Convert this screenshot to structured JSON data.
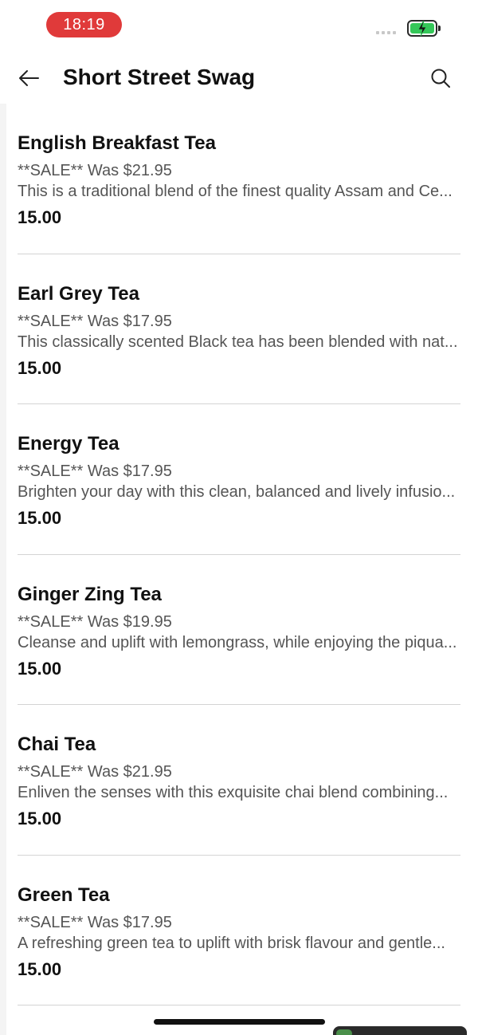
{
  "status_bar": {
    "time": "18:19"
  },
  "app_bar": {
    "title": "Short Street Swag",
    "back_icon": "arrow-left-icon",
    "search_icon": "search-icon"
  },
  "colors": {
    "time_pill": "#e03a3a",
    "battery_fill": "#35c759",
    "divider": "#d4d4d4"
  },
  "products": [
    {
      "name": "English Breakfast Tea",
      "sale": "**SALE** Was $21.95",
      "description": "This is a traditional blend of the finest quality Assam and Ce...",
      "price": "15.00"
    },
    {
      "name": "Earl Grey Tea",
      "sale": "**SALE** Was $17.95",
      "description": "This classically scented Black tea has been blended with nat...",
      "price": "15.00"
    },
    {
      "name": "Energy Tea",
      "sale": "**SALE** Was $17.95",
      "description": "Brighten your day with this clean, balanced and lively infusio...",
      "price": "15.00"
    },
    {
      "name": "Ginger Zing Tea",
      "sale": "**SALE** Was $19.95",
      "description": "Cleanse and uplift with lemongrass, while enjoying the piqua...",
      "price": "15.00"
    },
    {
      "name": "Chai Tea",
      "sale": "**SALE** Was $21.95",
      "description": "Enliven the senses with this exquisite chai blend combining...",
      "price": "15.00"
    },
    {
      "name": "Green Tea",
      "sale": "**SALE** Was $17.95",
      "description": "A refreshing green tea to uplift with brisk flavour and gentle...",
      "price": "15.00"
    }
  ]
}
